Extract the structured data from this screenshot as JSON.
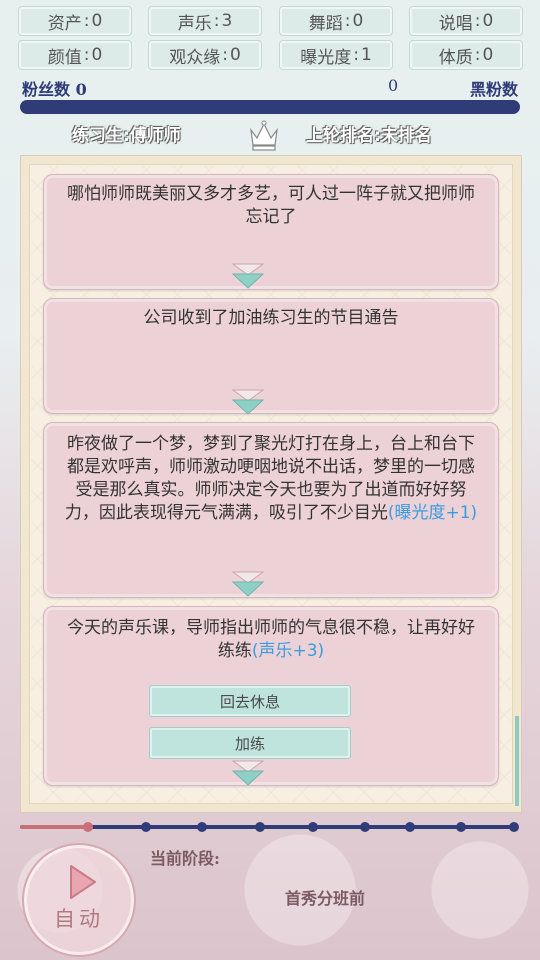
{
  "stats": [
    {
      "label": "资产",
      "value": "0"
    },
    {
      "label": "声乐",
      "value": "3"
    },
    {
      "label": "舞蹈",
      "value": "0"
    },
    {
      "label": "说唱",
      "value": "0"
    },
    {
      "label": "颜值",
      "value": "0"
    },
    {
      "label": "观众缘",
      "value": "0"
    },
    {
      "label": "曝光度",
      "value": "1"
    },
    {
      "label": "体质",
      "value": "0"
    }
  ],
  "fans": {
    "label": "粉丝数 0",
    "middle_value": "0",
    "black_label": "黑粉数"
  },
  "trainee": {
    "label": "练习生:傅师师"
  },
  "rank": {
    "label": "上轮排名:未排名"
  },
  "events": [
    {
      "text": "哪怕师师既美丽又多才多艺，可人过一阵子就又把师师忘记了",
      "highlight": ""
    },
    {
      "text": "公司收到了加油练习生的节目通告",
      "highlight": ""
    },
    {
      "text": "昨夜做了一个梦，梦到了聚光灯打在身上，台上和台下都是欢呼声，师师激动哽咽地说不出话，梦里的一切感受是那么真实。师师决定今天也要为了出道而好好努力，因此表现得元气满满，吸引了不少目光",
      "highlight": "(曝光度+1)"
    },
    {
      "text": "今天的声乐课，导师指出师师的气息很不稳，让再好好练练",
      "highlight": "(声乐+3)"
    }
  ],
  "choices": [
    "回去休息",
    "加练"
  ],
  "progress": {
    "current_index": 1,
    "total": 10
  },
  "auto_button": {
    "label": "自动"
  },
  "stage": {
    "label": "当前阶段:",
    "value": "首秀分班前"
  },
  "colors": {
    "accent_navy": "#2f3c78",
    "card_pink": "#ecd1d6",
    "choice_teal": "#bfe3dd",
    "highlight_blue": "#3a9de0",
    "progress_done": "#c86f78"
  }
}
